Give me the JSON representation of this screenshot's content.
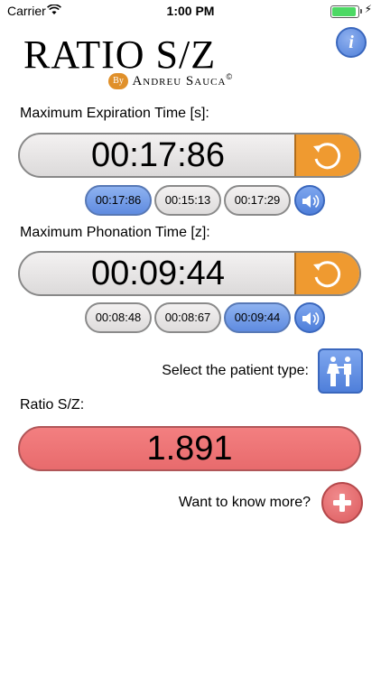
{
  "status_bar": {
    "carrier": "Carrier",
    "time": "1:00 PM"
  },
  "logo": {
    "title": "RATIO S/Z",
    "by": "By",
    "author": "Andreu Sauca",
    "copyright": "©"
  },
  "expiration": {
    "label": "Maximum Expiration Time [s]:",
    "value": "00:17:86",
    "attempts": [
      "00:17:86",
      "00:15:13",
      "00:17:29"
    ],
    "selected_index": 0
  },
  "phonation": {
    "label": "Maximum Phonation Time [z]:",
    "value": "00:09:44",
    "attempts": [
      "00:08:48",
      "00:08:67",
      "00:09:44"
    ],
    "selected_index": 2
  },
  "patient": {
    "label": "Select the patient type:"
  },
  "ratio": {
    "label": "Ratio S/Z:",
    "value": "1.891"
  },
  "more": {
    "label": "Want to know more?"
  },
  "colors": {
    "accent_orange": "#ef9a30",
    "accent_blue": "#5f8be0",
    "ratio_red": "#ee7677"
  },
  "icons": {
    "info": "info-icon",
    "reset": "reset-icon",
    "speaker": "speaker-icon",
    "patient": "adults-icon",
    "more": "plus-icon",
    "wifi": "wifi-icon",
    "battery": "battery-icon"
  }
}
